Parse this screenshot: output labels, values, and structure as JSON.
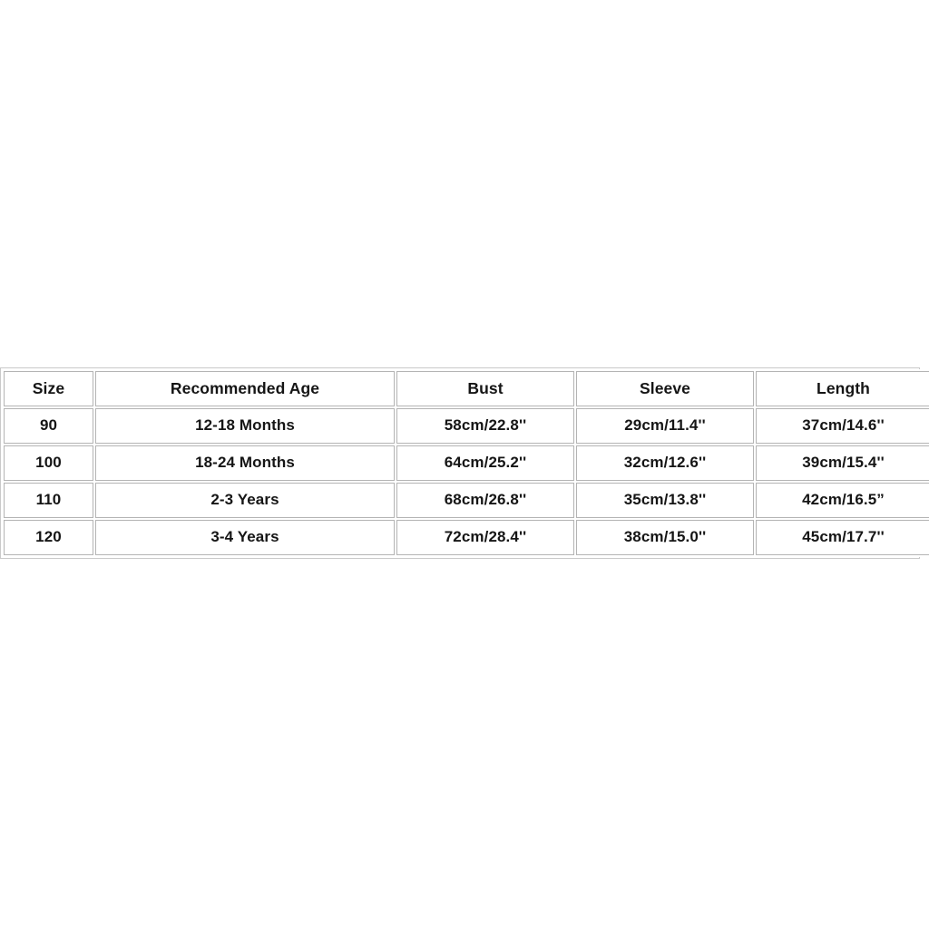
{
  "page": {
    "background_color": "#ffffff",
    "text_color": "#151515",
    "border_color": "#b4b4b4"
  },
  "size_chart": {
    "columns": [
      {
        "key": "size",
        "label": "Size"
      },
      {
        "key": "age",
        "label": "Recommended Age"
      },
      {
        "key": "bust",
        "label": "Bust"
      },
      {
        "key": "sleeve",
        "label": "Sleeve"
      },
      {
        "key": "length",
        "label": "Length"
      }
    ],
    "rows": [
      {
        "size": "90",
        "age": "12-18 Months",
        "bust": "58cm/22.8''",
        "sleeve": "29cm/11.4''",
        "length": "37cm/14.6''"
      },
      {
        "size": "100",
        "age": "18-24 Months",
        "bust": "64cm/25.2''",
        "sleeve": "32cm/12.6''",
        "length": "39cm/15.4''"
      },
      {
        "size": "110",
        "age": "2-3 Years",
        "bust": "68cm/26.8''",
        "sleeve": "35cm/13.8''",
        "length": "42cm/16.5”"
      },
      {
        "size": "120",
        "age": "3-4 Years",
        "bust": "72cm/28.4''",
        "sleeve": "38cm/15.0''",
        "length": "45cm/17.7''"
      }
    ]
  }
}
